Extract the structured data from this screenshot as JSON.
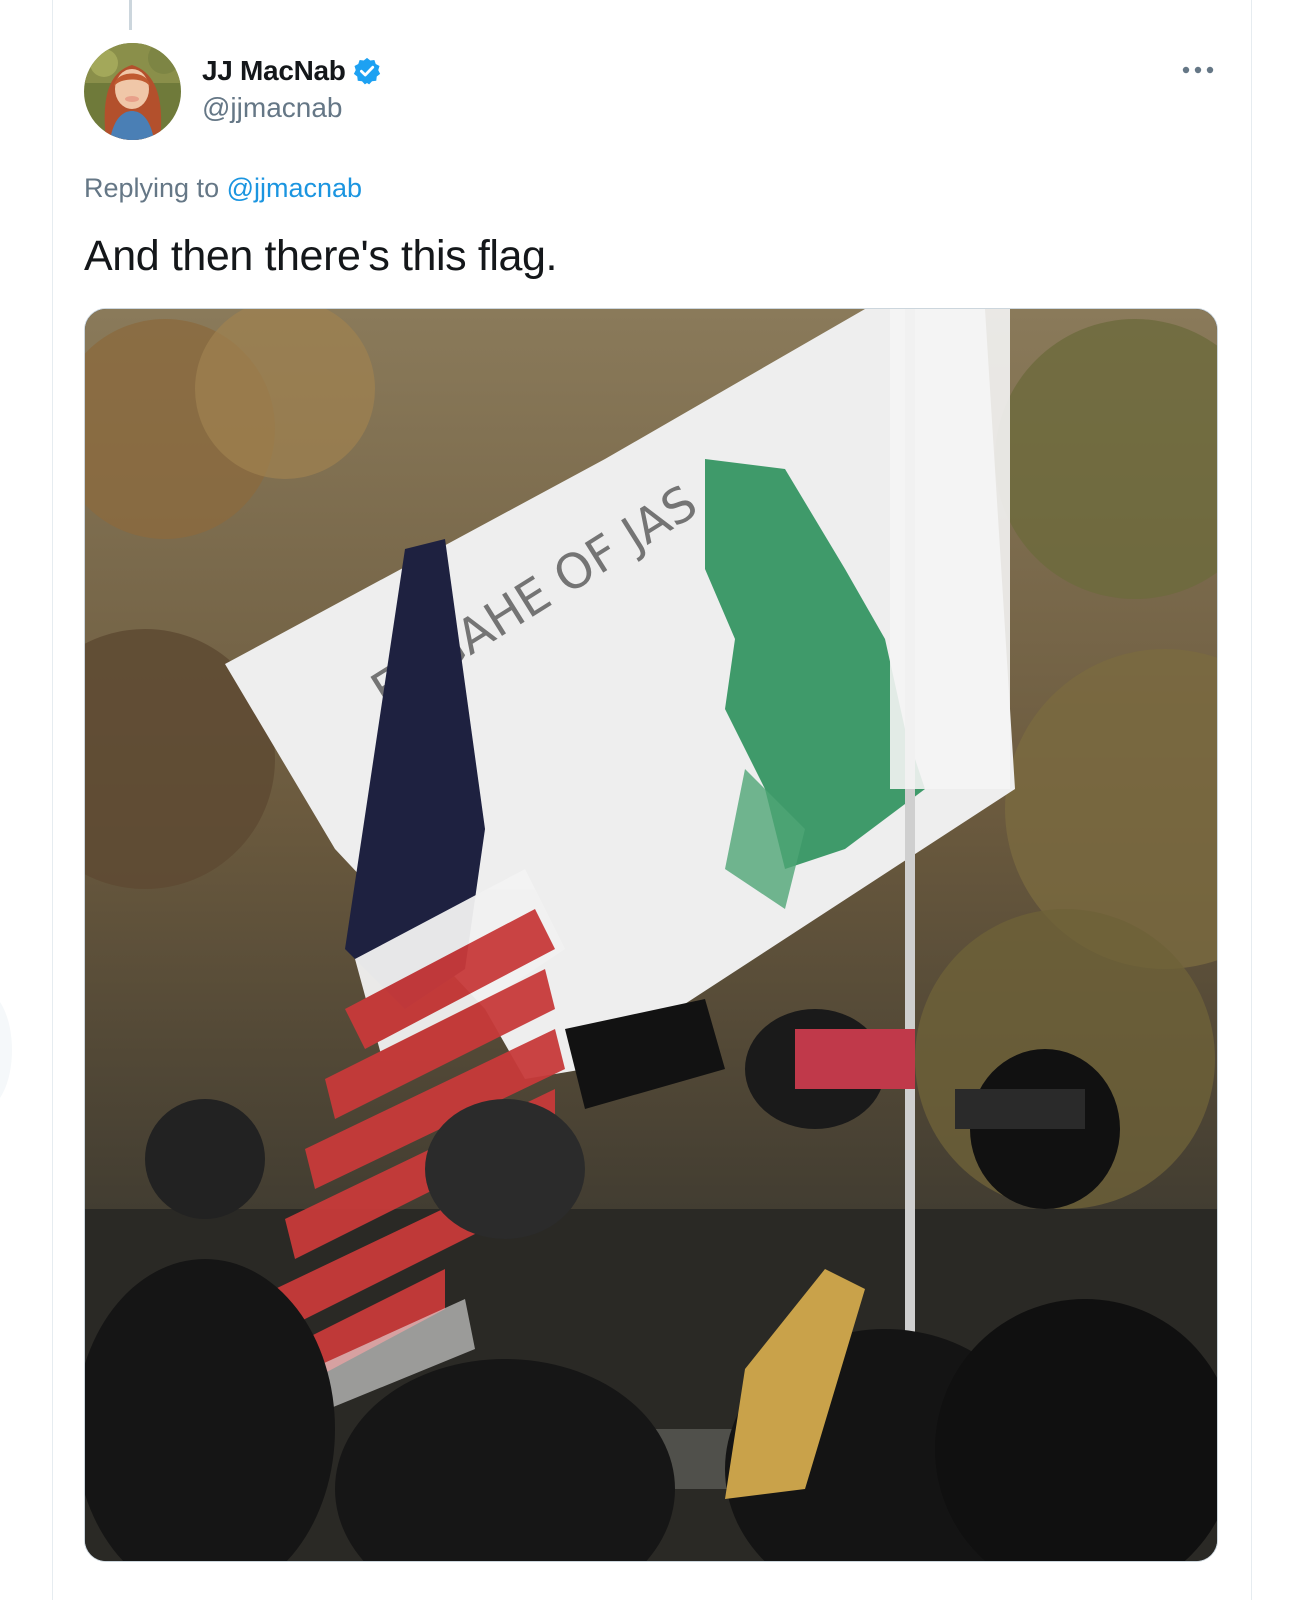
{
  "tweet": {
    "user": {
      "display_name": "JJ MacNab",
      "handle": "@jjmacnab",
      "verified": true,
      "avatar": "avatar-photo"
    },
    "replying_to": {
      "prefix": "Replying to",
      "handle": "@jjmacnab"
    },
    "text": "And then there's this flag.",
    "media": {
      "type": "video-still",
      "description_icon": "video-frame"
    },
    "menu_icon": "more-icon"
  },
  "colors": {
    "link": "#1b95e0",
    "verified": "#1da1f2",
    "text": "#14171a",
    "secondary": "#657786",
    "border": "#e6ecf0"
  }
}
